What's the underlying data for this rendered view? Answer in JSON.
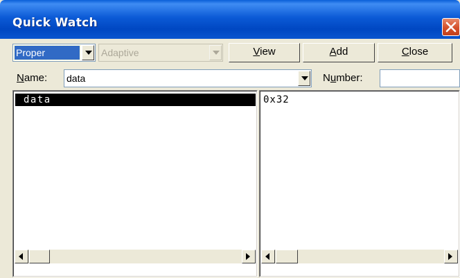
{
  "window": {
    "title": "Quick Watch"
  },
  "toolbar": {
    "mode_value": "Proper",
    "adaptive_value": "Adaptive",
    "view_label_u": "V",
    "view_label_rest": "iew",
    "add_label_u": "A",
    "add_label_rest": "dd",
    "close_label_u": "C",
    "close_label_rest": "lose"
  },
  "name_row": {
    "name_label_u": "N",
    "name_label_rest": "ame:",
    "name_value": "data",
    "number_label_pre": "N",
    "number_label_u": "u",
    "number_label_rest": "mber:",
    "number_value": ""
  },
  "symbols": {
    "items": [
      "data"
    ]
  },
  "values": {
    "items": [
      "0x32"
    ]
  },
  "colors": {
    "titlebar": "#0054e3",
    "selection": "#000000",
    "face": "#ece9d8"
  }
}
